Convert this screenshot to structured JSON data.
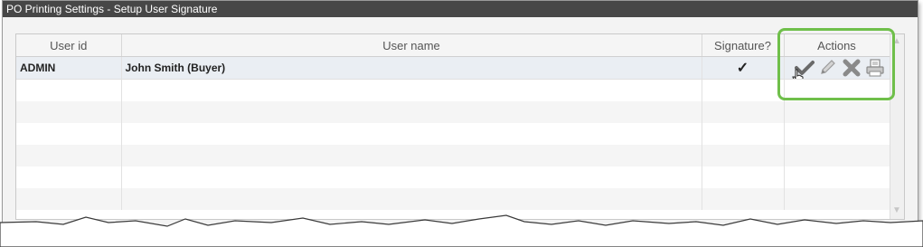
{
  "window": {
    "title": "PO Printing Settings - Setup User Signature"
  },
  "table": {
    "columns": [
      "User id",
      "User name",
      "Signature?",
      "Actions"
    ],
    "rows": [
      {
        "user_id": "ADMIN",
        "user_name": "John Smith (Buyer)",
        "signature": "✓"
      }
    ]
  },
  "actions": [
    "checkmark-icon",
    "pencil-icon",
    "delete-x-icon",
    "printer-icon"
  ],
  "colors": {
    "titlebar": "#474747",
    "highlight": "#6fbf4a"
  }
}
